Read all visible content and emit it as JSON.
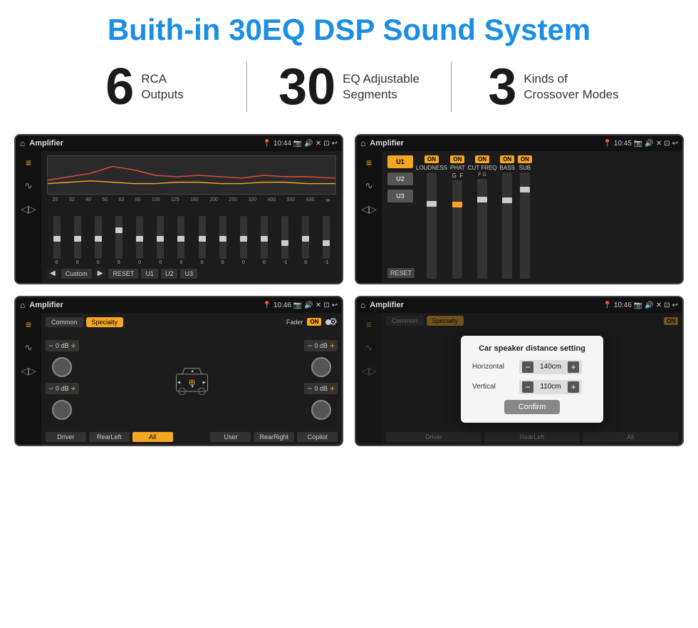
{
  "header": {
    "title": "Buith-in 30EQ DSP Sound System"
  },
  "stats": [
    {
      "number": "6",
      "label": "RCA\nOutputs"
    },
    {
      "number": "30",
      "label": "EQ Adjustable\nSegments"
    },
    {
      "number": "3",
      "label": "Kinds of\nCrossover Modes"
    }
  ],
  "screens": [
    {
      "id": "eq-screen",
      "topbar": {
        "title": "Amplifier",
        "time": "10:44"
      },
      "type": "eq"
    },
    {
      "id": "amp-screen",
      "topbar": {
        "title": "Amplifier",
        "time": "10:45"
      },
      "type": "amp2"
    },
    {
      "id": "crossover-screen",
      "topbar": {
        "title": "Amplifier",
        "time": "10:46"
      },
      "type": "crossover"
    },
    {
      "id": "dialog-screen",
      "topbar": {
        "title": "Amplifier",
        "time": "10:46"
      },
      "type": "dialog",
      "dialog": {
        "title": "Car speaker distance setting",
        "horizontal_label": "Horizontal",
        "horizontal_value": "140cm",
        "vertical_label": "Vertical",
        "vertical_value": "110cm",
        "confirm_label": "Confirm"
      }
    }
  ],
  "eq_freqs": [
    "25",
    "32",
    "40",
    "50",
    "63",
    "80",
    "100",
    "125",
    "160",
    "200",
    "250",
    "320",
    "400",
    "500",
    "630"
  ],
  "eq_values": [
    "0",
    "0",
    "0",
    "5",
    "0",
    "0",
    "0",
    "0",
    "0",
    "0",
    "0",
    "-1",
    "0",
    "-1",
    ""
  ],
  "channels": [
    "LOUDNESS",
    "PHAT",
    "CUT FREQ",
    "BASS",
    "SUB"
  ],
  "preset_buttons": [
    "U1",
    "U2",
    "U3"
  ],
  "crossover": {
    "tabs": [
      "Common",
      "Specialty"
    ],
    "fader_label": "Fader",
    "fader_on": "ON",
    "drivers": [
      "Driver",
      "RearLeft",
      "All",
      "RearRight",
      "Copilot",
      "User"
    ],
    "db_values": [
      "0 dB",
      "0 dB",
      "0 dB",
      "0 dB"
    ]
  },
  "dialog": {
    "title": "Car speaker distance setting",
    "horizontal_label": "Horizontal",
    "horizontal_value": "140cm",
    "vertical_label": "Vertical",
    "vertical_value": "110cm",
    "confirm_label": "Confirm"
  }
}
